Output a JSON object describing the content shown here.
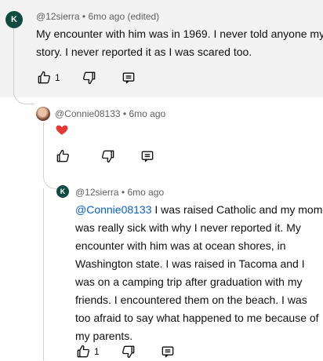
{
  "comments": [
    {
      "author": "@12sierra",
      "separator": "•",
      "time": "6mo ago (edited)",
      "avatar_letter": "K",
      "text": "My encounter with him was in 1969. I never told anyone my story. I never reported it as I was scared too.",
      "like_count": "1",
      "icons": [
        "thumbs-up-icon",
        "thumbs-down-icon",
        "reply-icon"
      ]
    },
    {
      "author": "@Connie08133",
      "separator": "•",
      "time": "6mo ago",
      "text_emoji": "heart",
      "like_count": "",
      "icons": [
        "thumbs-up-icon",
        "thumbs-down-icon",
        "reply-icon"
      ]
    },
    {
      "author": "@12sierra",
      "separator": "•",
      "time": "6mo ago",
      "avatar_letter": "K",
      "mention": "@Connie08133",
      "text": " I was raised Catholic and my mom was really sick with why I never reported it. My encounter with him was at ocean shores, in Washington state. I was raised in Tacoma and I was on a camping trip after graduation with my friends. I encountered them on the beach. I was too afraid to say what happened to me because of my parents.",
      "like_count": "1",
      "icons": [
        "thumbs-up-icon",
        "thumbs-down-icon",
        "reply-icon"
      ]
    }
  ],
  "colors": {
    "highlight_bg": "#f2f2f2",
    "avatar_k": "#0f4c3f",
    "mention": "#065fd4",
    "heart": "#e53935",
    "meta_text": "#606060"
  }
}
